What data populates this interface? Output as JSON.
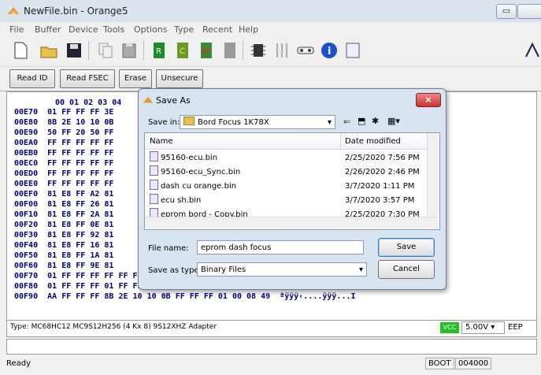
{
  "window": {
    "title": "NewFile.bin - Orange5"
  },
  "menu": [
    "File",
    "Buffer",
    "Device",
    "Tools",
    "Options",
    "Type",
    "Recent",
    "Help"
  ],
  "buttons": {
    "read_id": "Read ID",
    "read_fsec": "Read FSEC",
    "erase": "Erase",
    "unsecure": "Unsecure"
  },
  "hex": {
    "header": "00 01 02 03 04",
    "rows": [
      {
        "addr": "00E70",
        "data": "01 FF FF FF 3E"
      },
      {
        "addr": "00E80",
        "data": "8B 2E 10 10 0B"
      },
      {
        "addr": "00E90",
        "data": "50 FF 20 50 FF"
      },
      {
        "addr": "00EA0",
        "data": "FF FF FF FF FF"
      },
      {
        "addr": "00EB0",
        "data": "FF FF FF FF FF"
      },
      {
        "addr": "00EC0",
        "data": "FF FF FF FF FF"
      },
      {
        "addr": "00ED0",
        "data": "FF FF FF FF FF"
      },
      {
        "addr": "00EE0",
        "data": "FF FF FF FF FF"
      },
      {
        "addr": "00EF0",
        "data": "81 E8 FF A2 81"
      },
      {
        "addr": "00F00",
        "data": "81 E8 FF 26 81"
      },
      {
        "addr": "00F10",
        "data": "81 E8 FF 2A 81"
      },
      {
        "addr": "00F20",
        "data": "81 E8 FF 0E 81"
      },
      {
        "addr": "00F30",
        "data": "81 E8 FF 92 81"
      },
      {
        "addr": "00F40",
        "data": "81 E8 FF 16 81"
      },
      {
        "addr": "00F50",
        "data": "81 E8 FF 1A 81"
      },
      {
        "addr": "00F60",
        "data": "81 E8 FF 9E 81"
      },
      {
        "addr": "00F70",
        "data": "01 FF FF FF FF FF FF FF FF FF FF FF FF FF FF FF",
        "ascii": ".ÿÿÿÿÿÿÿÿÿÿÿÿÿÿÿ"
      },
      {
        "addr": "00F80",
        "data": "01 FF FF FF 01 FF FF FF 3E FF FF FF 02 FF FF FF",
        "ascii": ".ÿÿÿ.ÿÿÿ>ÿÿÿ.ÿÿÿ"
      },
      {
        "addr": "00F90",
        "data": "AA FF FF FF 8B 2E 10 10 0B FF FF FF 01 00 08 49",
        "ascii": "ªÿÿÿ‹....ÿÿÿ...I"
      }
    ]
  },
  "type_line": "Type: MC68HC12 MC9S12H256 (4 Kx 8)  9S12XHZ Adapter",
  "vcc": {
    "label": "VCC",
    "value": "5.00V",
    "extra": "EEP"
  },
  "status": {
    "left": "Ready",
    "boot": "BOOT",
    "addr": "004000"
  },
  "dialog": {
    "title": "Save As",
    "save_in_label": "Save in:",
    "save_in_value": "Bord Focus 1K78X",
    "col_name": "Name",
    "col_date": "Date modified",
    "files": [
      {
        "name": "95160-ecu.bin",
        "date": "2/25/2020 7:56 PM"
      },
      {
        "name": "95160-ecu_Sync.bin",
        "date": "2/26/2020 2:46 PM"
      },
      {
        "name": "dash cu orange.bin",
        "date": "3/7/2020 1:11 PM"
      },
      {
        "name": "ecu sh.bin",
        "date": "3/7/2020 3:57 PM"
      },
      {
        "name": "eprom bord - Copy.bin",
        "date": "2/25/2020 7:30 PM"
      }
    ],
    "file_name_label": "File name:",
    "file_name_value": "eprom dash focus",
    "save_type_label": "Save as type:",
    "save_type_value": "Binary Files",
    "save_button": "Save",
    "cancel_button": "Cancel",
    "close_glyph": "×"
  }
}
